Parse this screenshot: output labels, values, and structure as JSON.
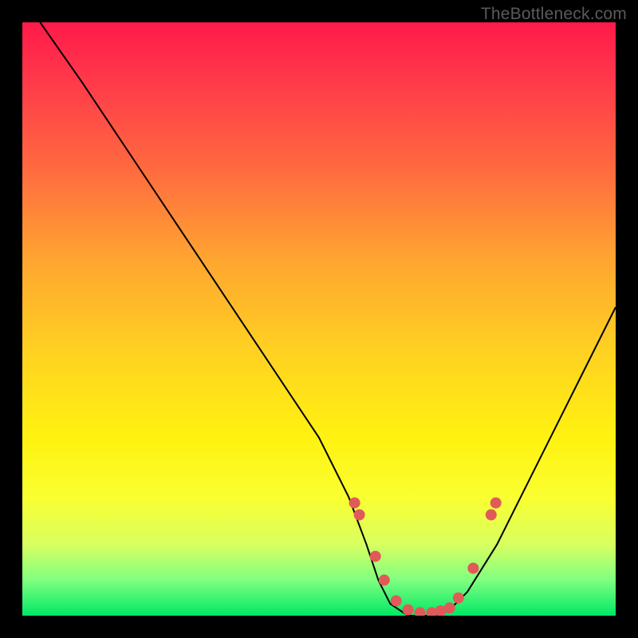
{
  "watermark": "TheBottleneck.com",
  "chart_data": {
    "type": "line",
    "title": "",
    "xlabel": "",
    "ylabel": "",
    "xlim": [
      0,
      100
    ],
    "ylim": [
      0,
      100
    ],
    "series": [
      {
        "name": "curve",
        "x": [
          3,
          10,
          20,
          30,
          40,
          50,
          55,
          58,
          60,
          62,
          65,
          68,
          70,
          72,
          75,
          80,
          88,
          95,
          100
        ],
        "y": [
          100,
          90,
          75,
          60,
          45,
          30,
          20,
          12,
          6,
          2,
          0,
          0,
          0,
          1,
          4,
          12,
          28,
          42,
          52
        ]
      }
    ],
    "markers": {
      "name": "dots",
      "color": "#e15a5a",
      "x": [
        56,
        56.8,
        59.5,
        61,
        63,
        65,
        67,
        69,
        70.5,
        72,
        73.5,
        76,
        79,
        79.8
      ],
      "y": [
        19,
        17,
        10,
        6,
        2.5,
        1,
        0.5,
        0.5,
        0.8,
        1.3,
        3,
        8,
        17,
        19
      ]
    }
  }
}
